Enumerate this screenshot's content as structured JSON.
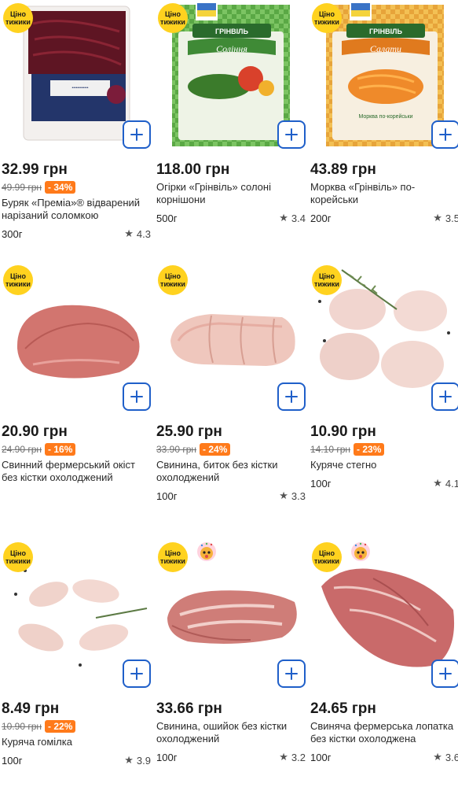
{
  "badge_text_line1": "Ціно",
  "badge_text_line2": "тижики",
  "products": [
    {
      "price": "32.99 грн",
      "old_price": "49.99 грн",
      "discount": "- 34%",
      "title": "Буряк «Преміа»® відварений нарізаний соломкою",
      "weight": "300г",
      "rating": "4.3"
    },
    {
      "price": "118.00 грн",
      "old_price": "",
      "discount": "",
      "title": "Огірки «Грінвіль» солоні корнішони",
      "weight": "500г",
      "rating": "3.4"
    },
    {
      "price": "43.89 грн",
      "old_price": "",
      "discount": "",
      "title": "Морква «Грінвіль» по-корейськи",
      "weight": "200г",
      "rating": "3.5"
    },
    {
      "price": "20.90 грн",
      "old_price": "24.90 грн",
      "discount": "- 16%",
      "title": "Свинний фермерський окіст без кістки охолоджений",
      "weight": "100г",
      "rating": ""
    },
    {
      "price": "25.90 грн",
      "old_price": "33.90 грн",
      "discount": "- 24%",
      "title": "Свинина, биток без кістки охолоджений",
      "weight": "100г",
      "rating": "3.3"
    },
    {
      "price": "10.90 грн",
      "old_price": "14.10 грн",
      "discount": "- 23%",
      "title": "Куряче стегно",
      "weight": "100г",
      "rating": "4.1"
    },
    {
      "price": "8.49 грн",
      "old_price": "10.90 грн",
      "discount": "- 22%",
      "title": "Куряча гомілка",
      "weight": "100г",
      "rating": "3.9"
    },
    {
      "price": "33.66 грн",
      "old_price": "",
      "discount": "",
      "title": "Свинина, ошийок без кістки охолоджений",
      "weight": "100г",
      "rating": "3.2"
    },
    {
      "price": "24.65 грн",
      "old_price": "",
      "discount": "",
      "title": "Свиняча фермерська лопатка без кістки охолоджена",
      "weight": "100г",
      "rating": "3.6"
    }
  ],
  "package_labels": {
    "greenville": "ГРІНВІЛЬ",
    "pickles": "Соління",
    "salads": "Салати",
    "carrot": "Морква по-корейськи",
    "made_in_ua": "ЗРОБЛЕНО В УКРАЇНІ"
  },
  "colors": {
    "badge": "#ffd21f",
    "accent_blue": "#1f5fc9",
    "discount": "#ff7a1a"
  },
  "icons": {
    "add": "plus-icon",
    "star": "star-icon"
  }
}
